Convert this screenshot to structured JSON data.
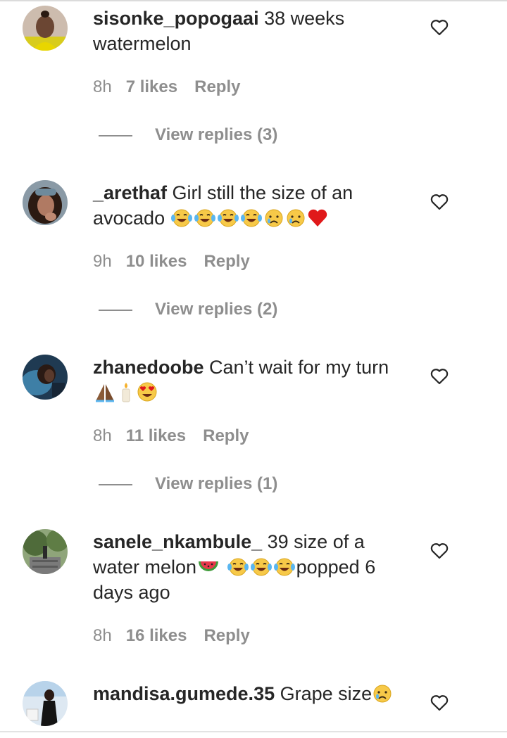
{
  "comments": [
    {
      "username": "sisonke_popogaai",
      "text": " 38 weeks watermelon",
      "time": "8h",
      "likes": "7 likes",
      "reply": "Reply",
      "view_replies": "View replies (3)",
      "like_icon": "heart-outline-icon",
      "avatar_colors": [
        "#c9b8a8",
        "#e8d600",
        "#5a3d2b"
      ]
    },
    {
      "username": "_arethaf",
      "text": " Girl still the size of an avocado",
      "emojis": [
        "face-with-tears-of-joy",
        "face-with-tears-of-joy",
        "face-with-tears-of-joy",
        "face-with-tears-of-joy",
        "crying-face",
        "crying-face",
        "red-heart"
      ],
      "time": "9h",
      "likes": "10 likes",
      "reply": "Reply",
      "view_replies": "View replies (2)",
      "like_icon": "heart-outline-icon",
      "avatar_colors": [
        "#6e8a9c",
        "#3a2418",
        "#b97f6a"
      ]
    },
    {
      "username": "zhanedoobe",
      "text": " Can’t wait for my turn",
      "emojis": [
        "folded-hands",
        "candle",
        "smiling-face-with-heart-eyes"
      ],
      "time": "8h",
      "likes": "11 likes",
      "reply": "Reply",
      "view_replies": "View replies (1)",
      "like_icon": "heart-outline-icon",
      "avatar_colors": [
        "#2a4f6e",
        "#4ba0c8",
        "#1a2a3a"
      ]
    },
    {
      "username": "sanele_nkambule_",
      "text_before": " 39 size of a water melon",
      "emojis": [
        "watermelon",
        "face-with-tears-of-joy",
        "face-with-tears-of-joy",
        "face-with-tears-of-joy"
      ],
      "text_after": "popped 6 days ago",
      "time": "8h",
      "likes": "16 likes",
      "reply": "Reply",
      "like_icon": "heart-outline-icon",
      "avatar_colors": [
        "#4f6b3a",
        "#8fa57a",
        "#6b6b6b"
      ]
    },
    {
      "username": "mandisa.gumede.35",
      "text": " Grape size",
      "emojis": [
        "crying-face"
      ],
      "like_icon": "heart-outline-icon",
      "avatar_colors": [
        "#dbe7f3",
        "#1a1a1a",
        "#9ec1e0"
      ]
    }
  ],
  "colors": {
    "text": "#262626",
    "secondary": "#8e8e8e",
    "emoji_yellow": "#f7c948",
    "heart_red": "#e0191a"
  }
}
